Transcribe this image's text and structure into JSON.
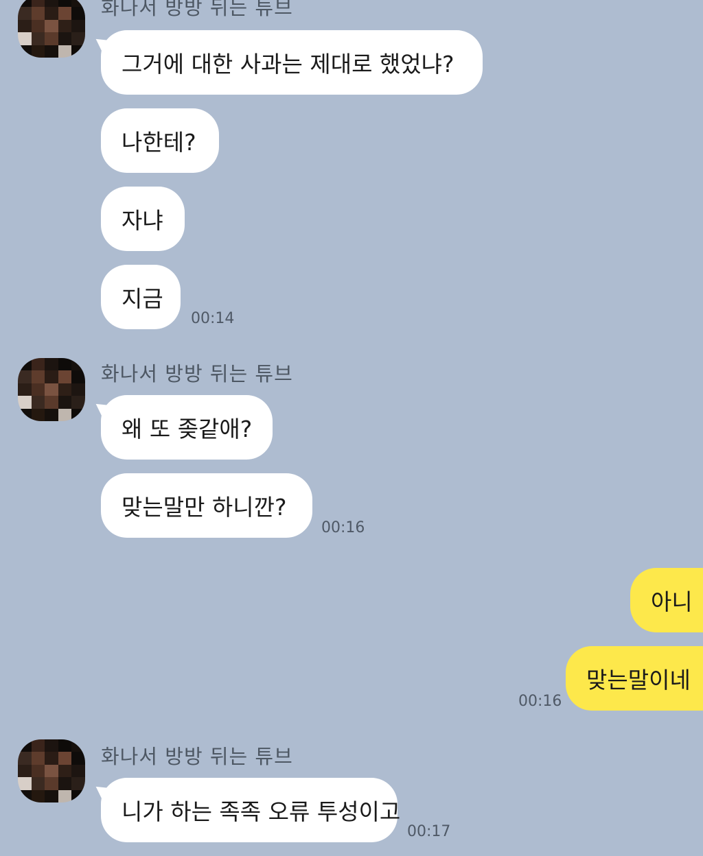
{
  "chat": {
    "sender_name": "화나서 방방 뒤는 튜브",
    "colors": {
      "background": "#aebcd0",
      "incoming_bubble": "#ffffff",
      "outgoing_bubble": "#fde84b"
    },
    "groups": [
      {
        "messages": [
          "그거에 대한 사과는 제대로 했었냐?",
          "나한테?",
          "자냐",
          "지금"
        ],
        "time": "00:14"
      },
      {
        "messages": [
          "왜 또 좆같애?",
          "맞는말만 하니깐?"
        ],
        "time": "00:16"
      },
      {
        "outgoing": true,
        "messages": [
          "아니",
          "맞는말이네"
        ],
        "time": "00:16"
      },
      {
        "messages": [
          "니가 하는 족족 오류 투성이고"
        ],
        "time": "00:17"
      }
    ]
  }
}
